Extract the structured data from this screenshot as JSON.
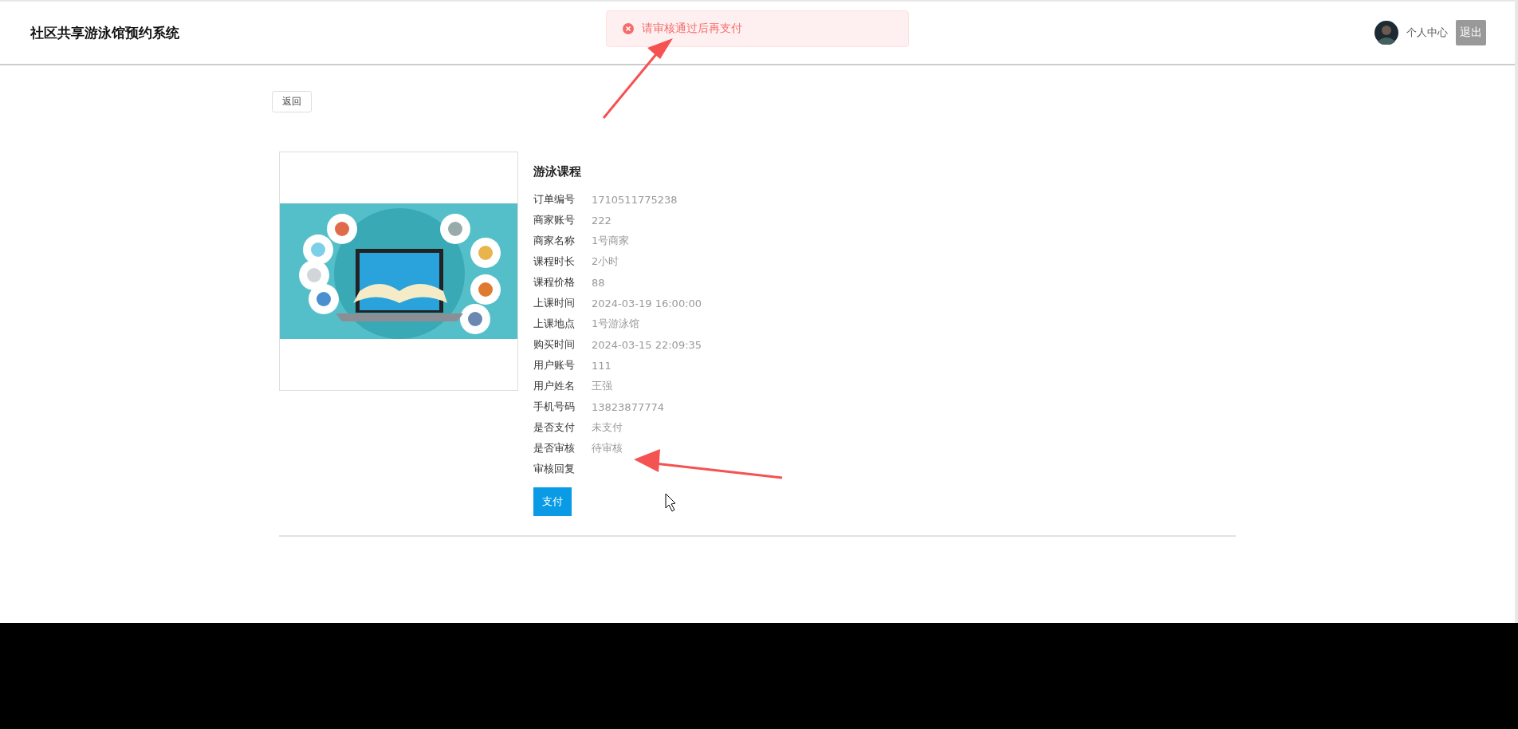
{
  "header": {
    "title": "社区共享游泳馆预约系统",
    "user_link": "个人中心",
    "logout": "退出"
  },
  "toast": {
    "message": "请审核通过后再支付"
  },
  "back_button": "返回",
  "detail": {
    "title": "游泳课程",
    "fields": [
      {
        "label": "订单编号",
        "value": "1710511775238"
      },
      {
        "label": "商家账号",
        "value": "222"
      },
      {
        "label": "商家名称",
        "value": "1号商家"
      },
      {
        "label": "课程时长",
        "value": "2小时"
      },
      {
        "label": "课程价格",
        "value": "88"
      },
      {
        "label": "上课时间",
        "value": "2024-03-19 16:00:00"
      },
      {
        "label": "上课地点",
        "value": "1号游泳馆"
      },
      {
        "label": "购买时间",
        "value": "2024-03-15 22:09:35"
      },
      {
        "label": "用户账号",
        "value": "111"
      },
      {
        "label": "用户姓名",
        "value": "王强"
      },
      {
        "label": "手机号码",
        "value": "13823877774"
      },
      {
        "label": "是否支付",
        "value": "未支付"
      },
      {
        "label": "是否审核",
        "value": "待审核"
      },
      {
        "label": "审核回复"
      }
    ],
    "pay_button": "支付"
  }
}
